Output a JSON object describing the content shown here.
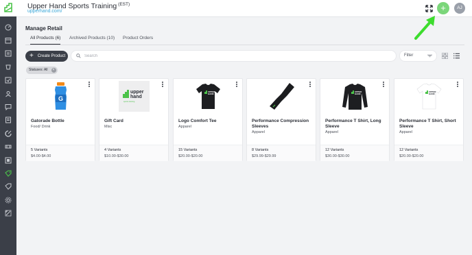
{
  "header": {
    "company_name": "Upper Hand Sports Training",
    "timezone": "(EST)",
    "company_url": "upperhand.com/",
    "add_button_label": "+",
    "avatar_initials": "AJ",
    "add_button_color": "#7bd67a",
    "arrow_color": "#3ddc2e"
  },
  "sidebar": {
    "icons": [
      "dashboard-icon",
      "calendar-icon",
      "clients-icon",
      "events-icon",
      "schedule-icon",
      "staff-icon",
      "messages-icon",
      "reports-icon",
      "payments-icon",
      "memberships-icon",
      "credit-passes-icon",
      "retail-icon",
      "coupons-icon",
      "settings-icon",
      "resources-icon"
    ],
    "active_index": 11
  },
  "page": {
    "title": "Manage Retail",
    "tabs": [
      {
        "label": "All Products (6)",
        "active": true
      },
      {
        "label": "Archived Products (10)",
        "active": false
      },
      {
        "label": "Product Orders",
        "active": false
      }
    ]
  },
  "toolbar": {
    "create_label": "Create Product",
    "search_placeholder": "Search",
    "filter_label": "Filter"
  },
  "filter_chip": {
    "label": "Statuses: All",
    "close": "×"
  },
  "products": [
    {
      "name": "Gatorade Bottle",
      "type": "Food/ Drink",
      "variants": "5 Variants",
      "price": "$4.00-$4.00",
      "thumb": "bottle"
    },
    {
      "name": "Gift Card",
      "type": "Misc",
      "variants": "4 Variants",
      "price": "$10.00-$30.00",
      "thumb": "giftcard"
    },
    {
      "name": "Logo Comfort Tee",
      "type": "Apparel",
      "variants": "15 Variants",
      "price": "$20.00-$20.00",
      "thumb": "tee-black"
    },
    {
      "name": "Performance Compression Sleeves",
      "type": "Apparel",
      "variants": "8 Variants",
      "price": "$29.99-$29.99",
      "thumb": "sleeve"
    },
    {
      "name": "Performance T Shirt, Long Sleeve",
      "type": "Apparel",
      "variants": "12 Variants",
      "price": "$30.00-$30.00",
      "thumb": "longsleeve"
    },
    {
      "name": "Performance T Shirt, Short Sleeve",
      "type": "Apparel",
      "variants": "12 Variants",
      "price": "$20.00-$20.00",
      "thumb": "tee-white"
    }
  ],
  "gift_card_logo_text": [
    "upper",
    "hand",
    "sports training"
  ],
  "tee_logo_text": [
    "UPPER",
    "HAND"
  ]
}
